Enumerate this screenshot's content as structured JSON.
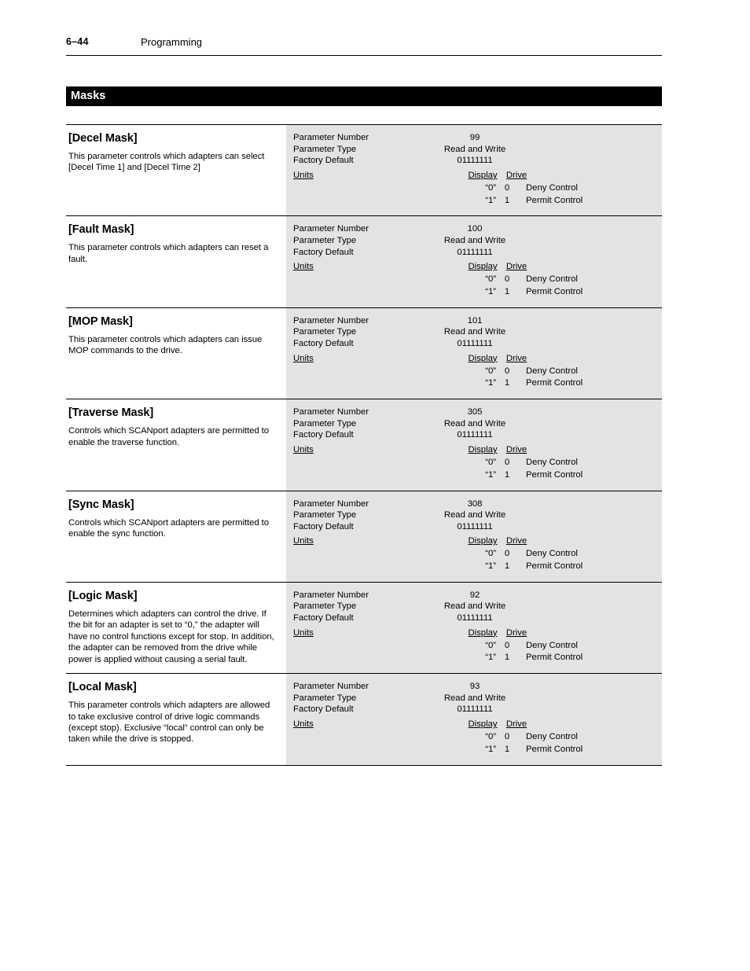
{
  "header": {
    "folio": "6–44",
    "chapter": "Programming"
  },
  "section": {
    "title": "Masks"
  },
  "spec_labels": {
    "parameter_number": "Parameter Number",
    "parameter_type": "Parameter Type",
    "factory_default": "Factory Default",
    "units": "Units",
    "display_col": "Display",
    "drive_col": "Drive"
  },
  "parameters": [
    {
      "title": "[Decel Mask]",
      "description": "This parameter controls which adapters can select [Decel Time 1] and [Decel Time 2]",
      "parameter_number": "99",
      "parameter_type": "Read and Write",
      "factory_default": "01111111",
      "options": [
        {
          "display": "“0”",
          "drive": "0",
          "meaning": "Deny Control"
        },
        {
          "display": "“1”",
          "drive": "1",
          "meaning": "Permit Control"
        }
      ]
    },
    {
      "title": "[Fault Mask]",
      "description": "This parameter controls which adapters can reset a fault.",
      "parameter_number": "100",
      "parameter_type": "Read and Write",
      "factory_default": "01111111",
      "options": [
        {
          "display": "“0”",
          "drive": "0",
          "meaning": "Deny Control"
        },
        {
          "display": "“1”",
          "drive": "1",
          "meaning": "Permit Control"
        }
      ]
    },
    {
      "title": "[MOP Mask]",
      "description": "This parameter controls which adapters can issue MOP commands to the drive.",
      "parameter_number": "101",
      "parameter_type": "Read and Write",
      "factory_default": "01111111",
      "options": [
        {
          "display": "“0”",
          "drive": "0",
          "meaning": "Deny Control"
        },
        {
          "display": "“1”",
          "drive": "1",
          "meaning": "Permit Control"
        }
      ]
    },
    {
      "title": "[Traverse Mask]",
      "description": "Controls which SCANport adapters are permitted to enable the traverse function.",
      "parameter_number": "305",
      "parameter_type": "Read and Write",
      "factory_default": "01111111",
      "options": [
        {
          "display": "“0”",
          "drive": "0",
          "meaning": "Deny Control"
        },
        {
          "display": "“1”",
          "drive": "1",
          "meaning": "Permit Control"
        }
      ]
    },
    {
      "title": "[Sync Mask]",
      "description": "Controls which SCANport adapters are permitted to enable the sync function.",
      "parameter_number": "308",
      "parameter_type": "Read and Write",
      "factory_default": "01111111",
      "options": [
        {
          "display": "“0”",
          "drive": "0",
          "meaning": "Deny Control"
        },
        {
          "display": "“1”",
          "drive": "1",
          "meaning": "Permit Control"
        }
      ]
    },
    {
      "title": "[Logic Mask]",
      "description": "Determines which adapters can control the drive. If the bit for an adapter is set to “0,” the adapter will have no control functions except for stop. In addition, the adapter can be removed from the drive while power is applied without causing a serial fault.",
      "parameter_number": "92",
      "parameter_type": "Read and Write",
      "factory_default": "01111111",
      "options": [
        {
          "display": "“0”",
          "drive": "0",
          "meaning": "Deny Control"
        },
        {
          "display": "“1”",
          "drive": "1",
          "meaning": "Permit Control"
        }
      ]
    },
    {
      "title": "[Local Mask]",
      "description": "This parameter controls which adapters are allowed to take exclusive control of drive logic commands (except stop). Exclusive “local” control can only be taken while the drive is stopped.",
      "parameter_number": "93",
      "parameter_type": "Read and Write",
      "factory_default": "01111111",
      "options": [
        {
          "display": "“0”",
          "drive": "0",
          "meaning": "Deny Control"
        },
        {
          "display": "“1”",
          "drive": "1",
          "meaning": "Permit Control"
        }
      ]
    }
  ]
}
